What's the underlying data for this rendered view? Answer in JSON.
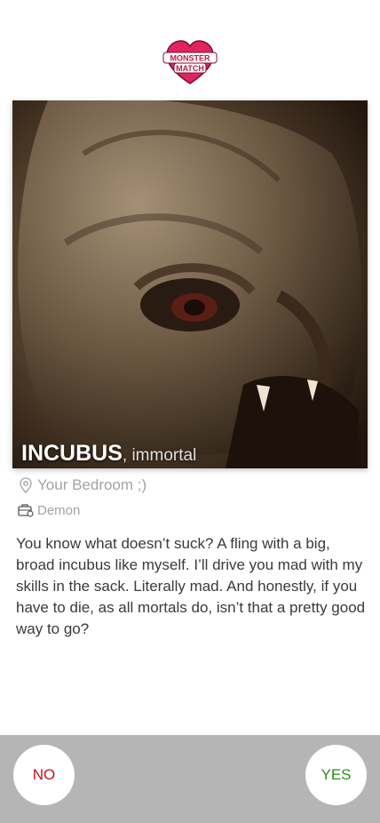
{
  "app": {
    "logo_text_line1": "MONSTER",
    "logo_text_line2": "MATCH"
  },
  "profile": {
    "name": "INCUBUS",
    "age": ", immortal",
    "location": "Your Bedroom ;)",
    "job": "Demon",
    "bio": "You know what doesn’t suck? A fling with a big, broad incubus like myself. I’ll drive you mad with my skills in the sack. Literally mad. And honestly, if you have to die, as all mortals do, isn’t that a pretty good way to go?"
  },
  "actions": {
    "no_label": "NO",
    "yes_label": "YES"
  },
  "colors": {
    "no": "#c0141c",
    "yes": "#2f8a1e",
    "bar": "#b5b5b5",
    "logo_heart": "#e0245e"
  },
  "icons": {
    "location": "map-pin-icon",
    "job": "briefcase-icon"
  }
}
